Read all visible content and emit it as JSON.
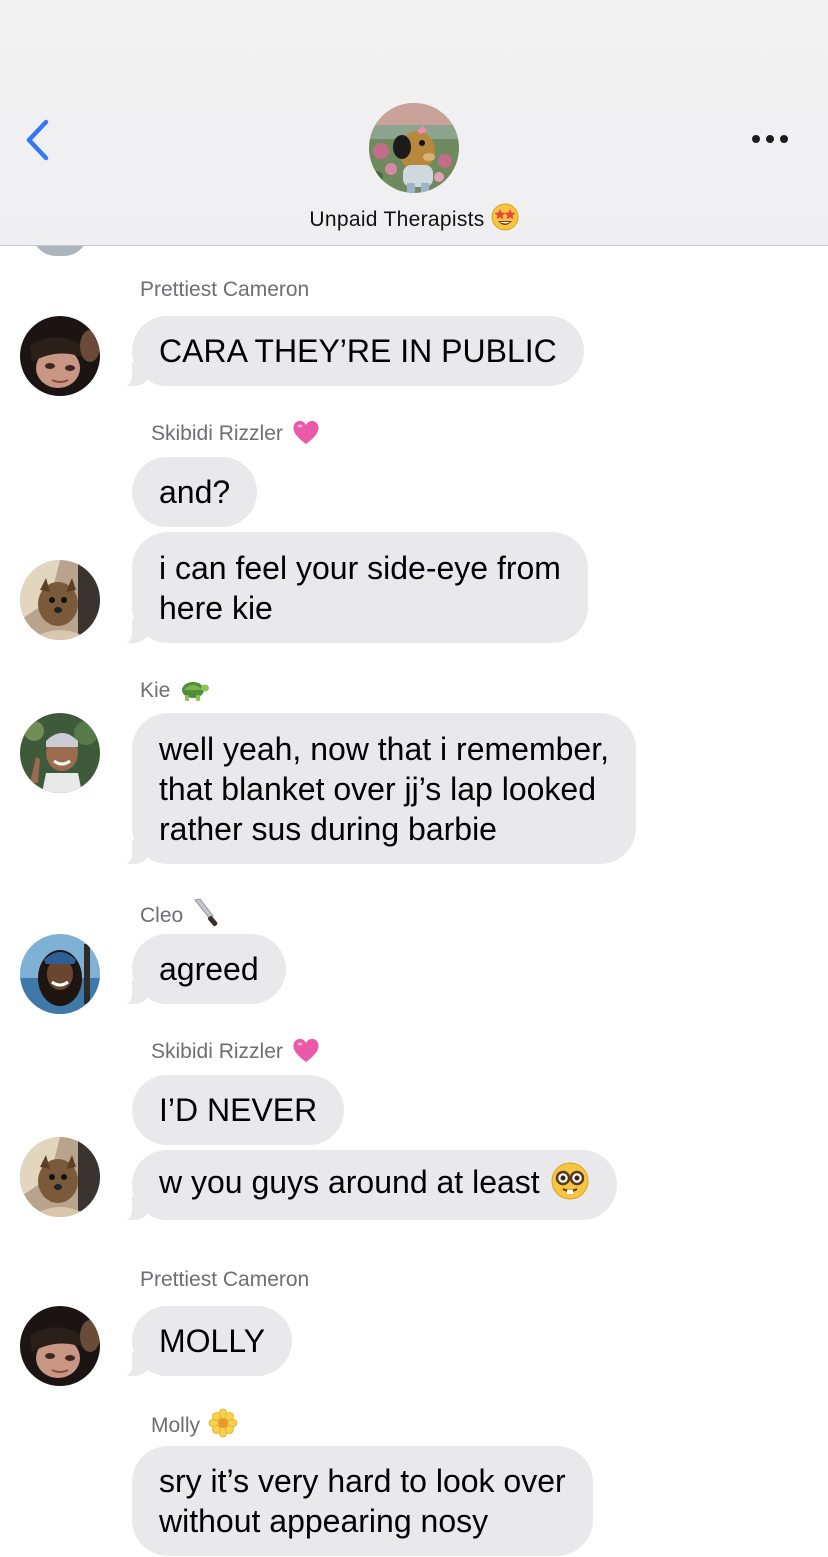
{
  "header": {
    "group_name": "Unpaid Therapists",
    "group_emoji": "star-struck-emoji",
    "back_icon": "chevron-left-icon",
    "more_icon": "ellipsis-icon",
    "accent": "#3478f6"
  },
  "messages": [
    {
      "sender": "Prettiest Cameron",
      "texts": [
        "CARA THEY’RE IN PUBLIC"
      ]
    },
    {
      "sender": "Skibidi Rizzler",
      "sender_emoji": "pink-heart-emoji",
      "texts": [
        "and?",
        "i can feel your side-eye from\nhere kie"
      ]
    },
    {
      "sender": "Kie",
      "sender_emoji": "turtle-emoji",
      "texts": [
        "well yeah, now that i remember,\nthat blanket over jj’s lap looked\nrather sus during barbie"
      ]
    },
    {
      "sender": "Cleo",
      "sender_emoji": "kitchen-knife-emoji",
      "texts": [
        "agreed"
      ]
    },
    {
      "sender": "Skibidi Rizzler",
      "sender_emoji": "pink-heart-emoji",
      "texts": [
        "I’D NEVER",
        "w you guys around at least"
      ],
      "trailing_emoji": "nerd-face-emoji"
    },
    {
      "sender": "Prettiest Cameron",
      "texts": [
        "MOLLY"
      ]
    },
    {
      "sender": "Molly",
      "sender_emoji": "blossom-emoji",
      "texts": [
        "sry it’s very hard to look over\nwithout appearing nosy"
      ]
    }
  ],
  "colors": {
    "bubble": "#e9e9eb",
    "sender_text": "#6e6e73",
    "background": "#ffffff"
  }
}
